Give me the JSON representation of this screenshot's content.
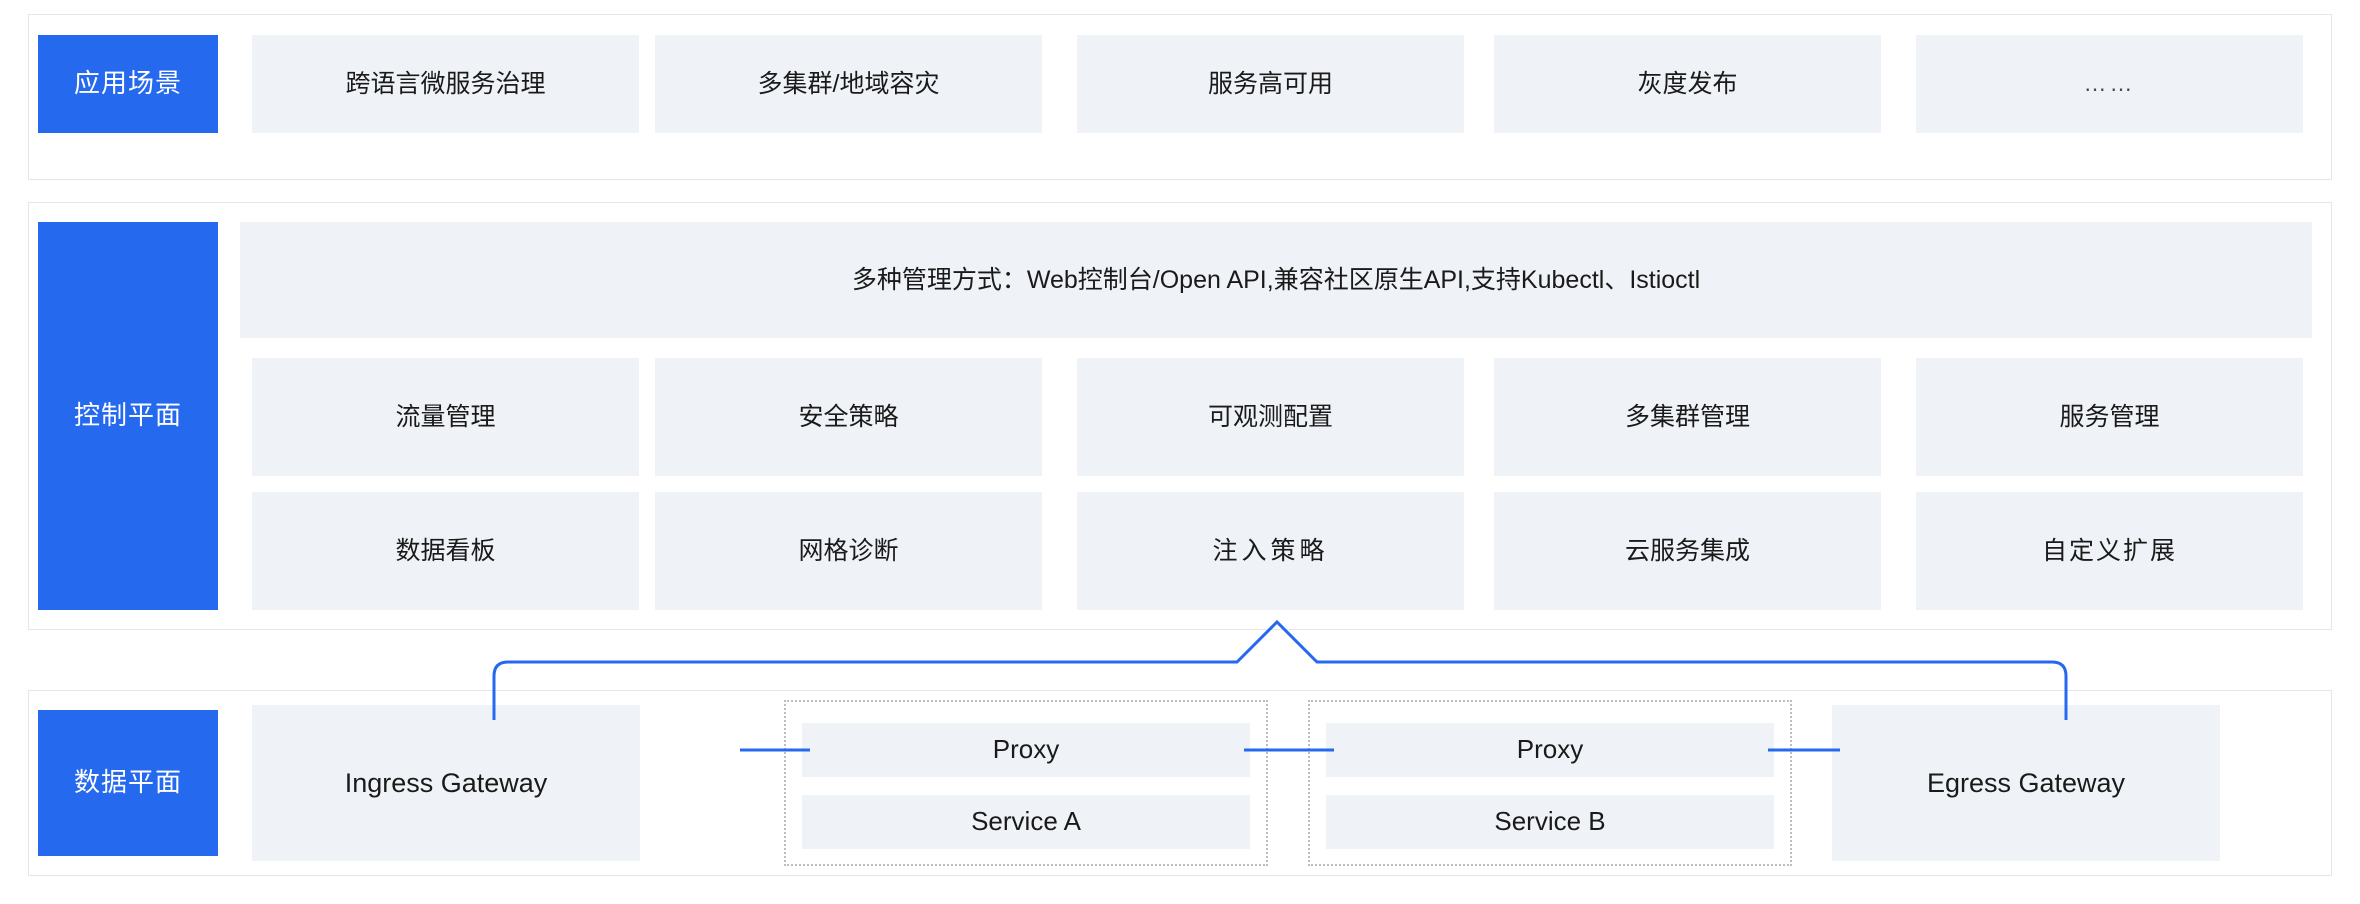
{
  "colors": {
    "accent_blue": "#2569ef",
    "cell_grey": "#eff2f6",
    "panel_border": "#e3e7ec",
    "dotted_border": "#b9bcc0",
    "connector_blue": "#2569ef"
  },
  "scenarios": {
    "layer_label": "应用场景",
    "items": [
      {
        "label": "跨语言微服务治理"
      },
      {
        "label": "多集群/地域容灾"
      },
      {
        "label": "服务高可用"
      },
      {
        "label": "灰度发布"
      },
      {
        "label": "……"
      }
    ]
  },
  "control_plane": {
    "layer_label": "控制平面",
    "banner": "多种管理方式：Web控制台/Open API,兼容社区原生API,支持Kubectl、Istioctl",
    "row1": [
      {
        "label": "流量管理"
      },
      {
        "label": "安全策略"
      },
      {
        "label": "可观测配置"
      },
      {
        "label": "多集群管理"
      },
      {
        "label": "服务管理"
      }
    ],
    "row2": [
      {
        "label": "数据看板"
      },
      {
        "label": "网格诊断"
      },
      {
        "label": "注入策略"
      },
      {
        "label": "云服务集成"
      },
      {
        "label": "自定义扩展"
      }
    ]
  },
  "data_plane": {
    "layer_label": "数据平面",
    "ingress_gateway": "Ingress Gateway",
    "egress_gateway": "Egress Gateway",
    "pod_a": {
      "proxy": "Proxy",
      "service": "Service A"
    },
    "pod_b": {
      "proxy": "Proxy",
      "service": "Service B"
    }
  }
}
